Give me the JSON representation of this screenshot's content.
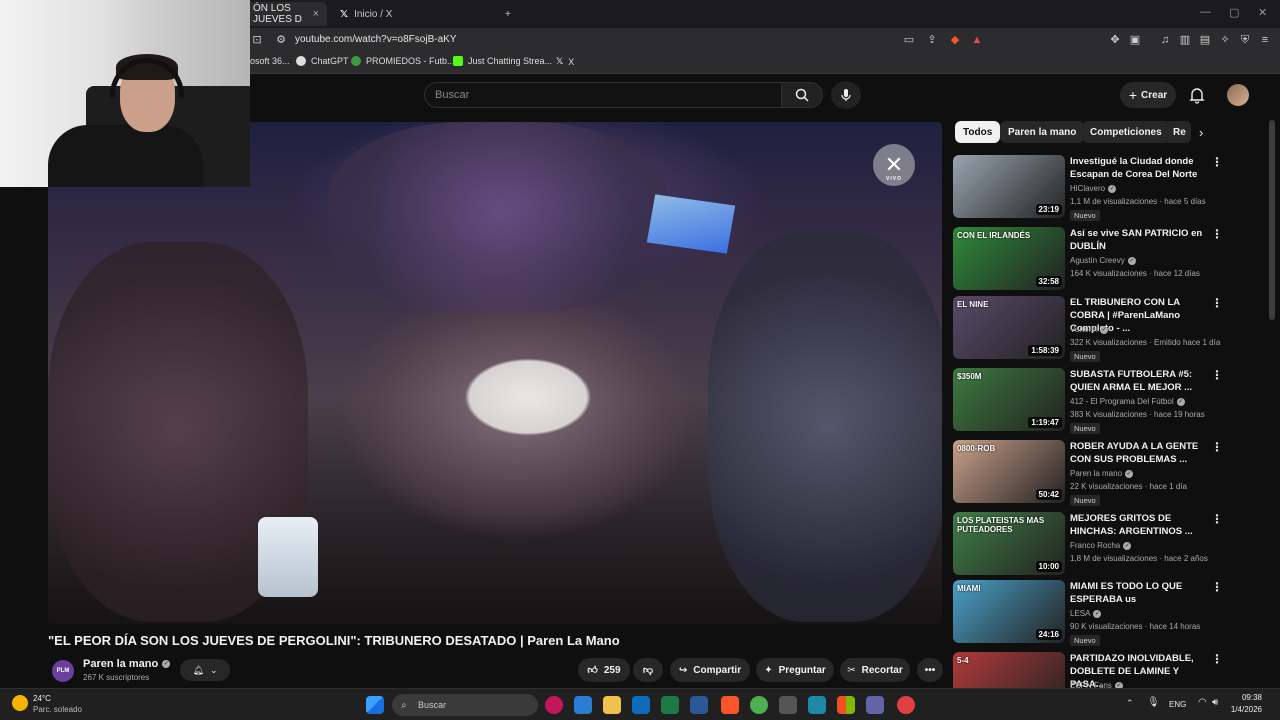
{
  "browser": {
    "tabs": [
      {
        "label": "ÓN LOS JUEVES D",
        "active": true
      },
      {
        "label": "Inicio / X",
        "active": false
      }
    ],
    "url": "youtube.com/watch?v=o8FsojB-aKY",
    "bookmarks": [
      {
        "label": "osoft 36..."
      },
      {
        "label": "ChatGPT"
      },
      {
        "label": "PROMIEDOS - Futb..."
      },
      {
        "label": "Just Chatting Strea..."
      },
      {
        "label": "X"
      }
    ]
  },
  "header": {
    "search_placeholder": "Buscar",
    "create_label": "Crear"
  },
  "video": {
    "title": "\"EL PEOR DÍA SON LOS JUEVES DE PERGOLINI\": TRIBUNERO DESATADO | Paren La Mano",
    "channel": "Paren la mano",
    "subscribers": "267 K suscriptores",
    "likes": "259",
    "share_label": "Compartir",
    "ask_label": "Preguntar",
    "clip_label": "Recortar",
    "live_badge": "VIVO",
    "channel_avatar_text": "PLM"
  },
  "chips": [
    "Todos",
    "Paren la mano",
    "Competiciones",
    "Re"
  ],
  "recommendations": [
    {
      "title": "Investigué la Ciudad donde Escapan de Corea Del Norte",
      "channel": "HiClavero",
      "meta": "1,1 M de visualizaciones · hace 5 días",
      "badge": "Nuevo",
      "duration": "23:19",
      "thumb_color": "#9aa5b0"
    },
    {
      "title": "Así se vive SAN PATRICIO en DUBLÍN",
      "channel": "Agustín Creevy",
      "meta": "164 K visualizaciones · hace 12 días",
      "badge": "",
      "duration": "32:58",
      "thumb_color": "#2f8a3a",
      "thumb_label": "CON EL IRLANDÉS"
    },
    {
      "title": "EL TRIBUNERO CON LA COBRA | #ParenLaMano Completo - ...",
      "channel": "Vorterix",
      "meta": "322 K visualizaciones · Emitido hace 1 día",
      "badge": "Nuevo",
      "duration": "1:58:39",
      "thumb_color": "#5a4a6a",
      "thumb_label": "EL NINE"
    },
    {
      "title": "SUBASTA FUTBOLERA #5: QUIEN ARMA EL MEJOR ...",
      "channel": "412 - El Programa Del Fútbol",
      "meta": "383 K visualizaciones · hace 19 horas",
      "badge": "Nuevo",
      "duration": "1:19:47",
      "thumb_color": "#3d7a3f",
      "thumb_label": "$350M"
    },
    {
      "title": "ROBER AYUDA A LA GENTE CON SUS PROBLEMAS ...",
      "channel": "Paren la mano",
      "meta": "22 K visualizaciones · hace 1 día",
      "badge": "Nuevo",
      "duration": "50:42",
      "thumb_color": "#c9a089",
      "thumb_label": "0800-ROB"
    },
    {
      "title": "MEJORES GRITOS DE HINCHAS: ARGENTINOS ...",
      "channel": "Franco Rocha",
      "meta": "1,8 M de visualizaciones · hace 2 años",
      "badge": "",
      "duration": "10:00",
      "thumb_color": "#3f7f45",
      "thumb_label": "LOS PLATEISTAS MAS PUTEADORES"
    },
    {
      "title": "MIAMI ES TODO LO QUE ESPERABA us",
      "channel": "LESA",
      "meta": "90 K visualizaciones · hace 14 horas",
      "badge": "Nuevo",
      "duration": "24:16",
      "thumb_color": "#4aa0c8",
      "thumb_label": "MIAMI"
    },
    {
      "title": "PARTIDAZO INOLVIDABLE, DOBLETE DE LAMINE Y PASA...",
      "channel": "ESPN Fans",
      "meta": "",
      "badge": "",
      "duration": "",
      "thumb_color": "#b23a3a",
      "thumb_label": "5-4"
    }
  ],
  "taskbar": {
    "temperature": "24°C",
    "weather": "Parc. soleado",
    "search_label": "Buscar",
    "language": "ENG",
    "time": "09:38",
    "date": "1/4/2026"
  }
}
